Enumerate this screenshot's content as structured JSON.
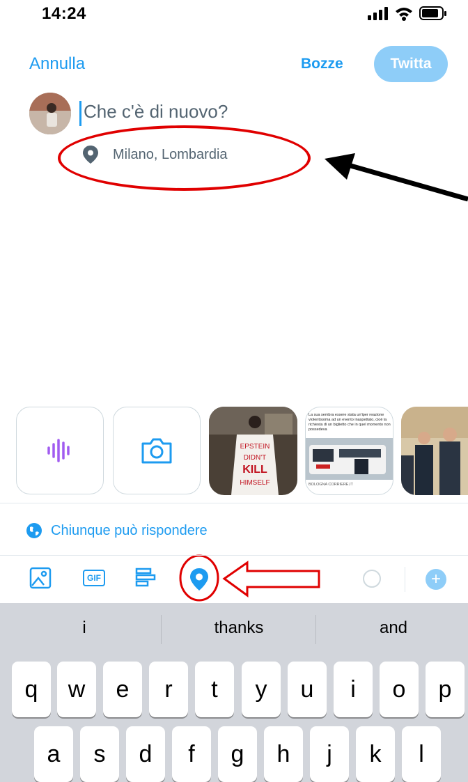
{
  "status_bar": {
    "time": "14:24"
  },
  "header": {
    "cancel_label": "Annulla",
    "drafts_label": "Bozze",
    "tweet_label": "Twitta"
  },
  "composer": {
    "placeholder": "Che c'è di nuovo?",
    "location": "Milano, Lombardia"
  },
  "media": {
    "photo1_text": "EPSTEIN DIDN'T KILL HIMSELF",
    "photo2_lines": [
      "La sua sembra essere stata un'iper reazione",
      "violentissima ad un evento inaspettato, cioè la",
      "richiesta di un biglietto che in quel momento non",
      "possedeva"
    ],
    "photo2_caption": "BOLOGNA CORRIERE.IT"
  },
  "reply_setting": {
    "label": "Chiunque può rispondere"
  },
  "keyboard": {
    "suggestions": [
      "i",
      "thanks",
      "and"
    ],
    "row1": [
      "q",
      "w",
      "e",
      "r",
      "t",
      "y",
      "u",
      "i",
      "o",
      "p"
    ],
    "row2": [
      "a",
      "s",
      "d",
      "f",
      "g",
      "h",
      "j",
      "k",
      "l"
    ]
  },
  "colors": {
    "accent": "#1d9bf0",
    "annotation": "#e00000",
    "tweet_disabled": "#8ecdf8"
  }
}
